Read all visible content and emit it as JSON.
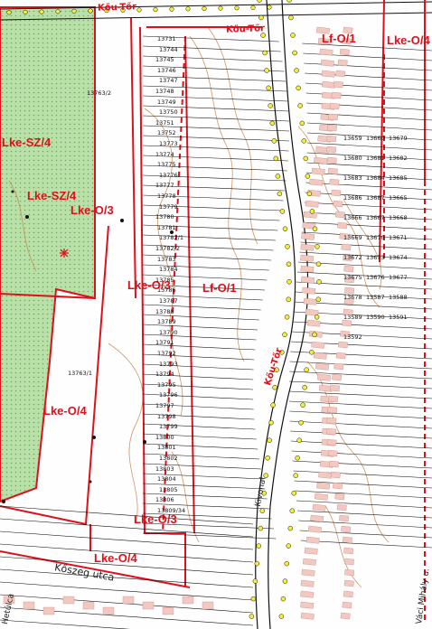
{
  "map": {
    "zones": [
      {
        "id": "lf-o-1-top",
        "label": "Lf-O/1"
      },
      {
        "id": "lke-o-4-top",
        "label": "Lke-O/4"
      },
      {
        "id": "lke-sz-4-a",
        "label": "Lke-SZ/4"
      },
      {
        "id": "lke-sz-4-b",
        "label": "Lke-SZ/4"
      },
      {
        "id": "lke-o-3-a",
        "label": "Lke-O/3"
      },
      {
        "id": "lke-o-3-b",
        "label": "Lke-O/3"
      },
      {
        "id": "lf-o-1-mid",
        "label": "Lf-O/1"
      },
      {
        "id": "lke-o-4-left",
        "label": "Lke-O/4"
      },
      {
        "id": "lke-o-3-c",
        "label": "Lke-O/3"
      },
      {
        "id": "lke-o-4-bottom",
        "label": "Lke-O/4"
      }
    ],
    "streets": [
      {
        "id": "kouto-road-top",
        "label": "Kőu-Tőr"
      },
      {
        "id": "kouto-road-mid",
        "label": "Kőu-Tőr"
      },
      {
        "id": "main-road-vertical",
        "label": "Kőu-Tőr"
      },
      {
        "id": "koszeg-utca",
        "label": "Kőszeg utca"
      },
      {
        "id": "side-street",
        "label": "Hetúlca"
      },
      {
        "id": "vaci-mihaly-utca",
        "label": "Váci Mihály u."
      },
      {
        "id": "kivonal-utca",
        "label": "Kivonal"
      }
    ],
    "parcels": [
      "13763/2",
      "13731",
      "13744",
      "13745",
      "13746",
      "13747",
      "13748",
      "13749",
      "13750",
      "13751",
      "13752",
      "13773",
      "13774",
      "13775",
      "13776",
      "13777",
      "13778",
      "13779",
      "13780",
      "13781",
      "13782/1",
      "13782/2",
      "13783",
      "13784",
      "13785",
      "13786",
      "13787",
      "13788",
      "13789",
      "13790",
      "13791",
      "13792",
      "13793",
      "13794",
      "13795",
      "13796",
      "13797",
      "13798",
      "13799",
      "13800",
      "13801",
      "13802",
      "13803",
      "13804",
      "13805",
      "13806",
      "13809/34",
      "13763/1",
      "13659",
      "13660",
      "13679",
      "13680",
      "13681",
      "13682",
      "13683",
      "13684",
      "13685",
      "13686",
      "13687",
      "13665",
      "13666",
      "13667",
      "13668",
      "13669",
      "13670",
      "13671",
      "13672",
      "13673",
      "13674",
      "13675",
      "13676",
      "13677",
      "13678",
      "13587",
      "13588",
      "13589",
      "13590",
      "13591",
      "13592"
    ],
    "colors": {
      "zone_boundary": "#e0101a",
      "agricultural_fill": "#b8e0a8",
      "contour": "#c8844a",
      "building": "#f2c9c1",
      "survey_point": "#f6ef3a",
      "cadastral_line": "#111111"
    }
  }
}
